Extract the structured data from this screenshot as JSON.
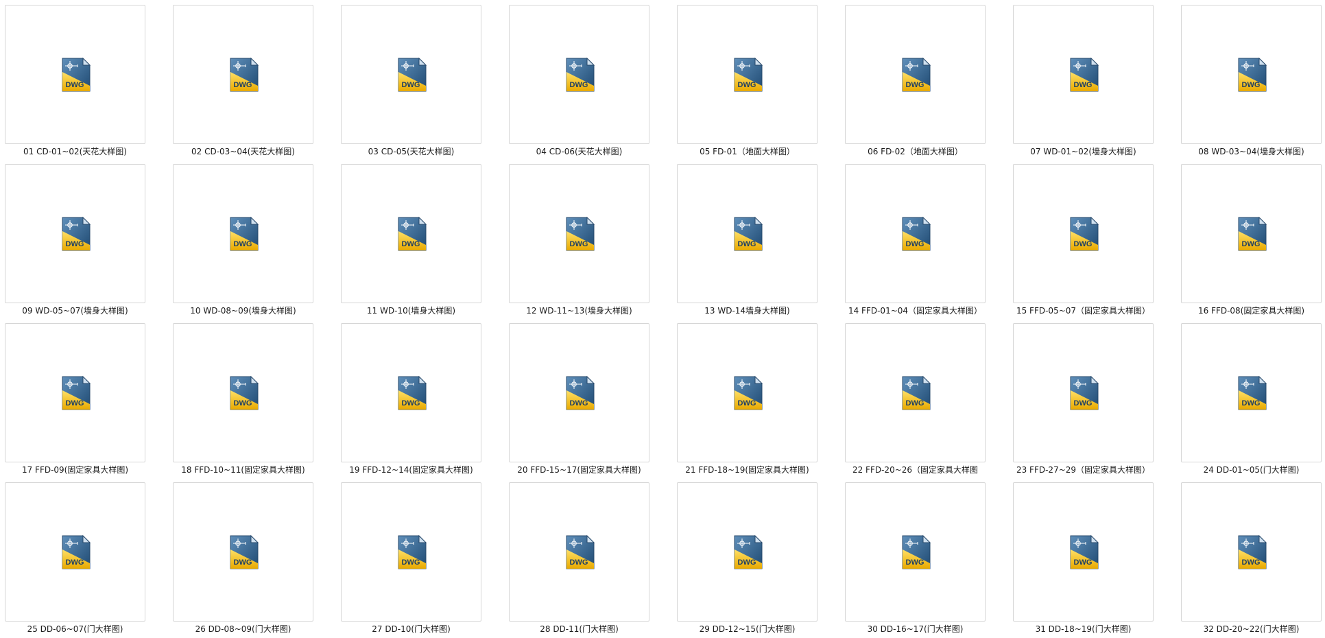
{
  "files": [
    {
      "name": "01 CD-01~02(天花大样图)",
      "icon": "dwg-file-icon"
    },
    {
      "name": "02 CD-03~04(天花大样图)",
      "icon": "dwg-file-icon"
    },
    {
      "name": "03 CD-05(天花大样图)",
      "icon": "dwg-file-icon"
    },
    {
      "name": "04 CD-06(天花大样图)",
      "icon": "dwg-file-icon"
    },
    {
      "name": "05 FD-01（地面大样图）",
      "icon": "dwg-file-icon"
    },
    {
      "name": "06 FD-02（地面大样图）",
      "icon": "dwg-file-icon"
    },
    {
      "name": "07 WD-01~02(墙身大样图)",
      "icon": "dwg-file-icon"
    },
    {
      "name": "08 WD-03~04(墙身大样图)",
      "icon": "dwg-file-icon"
    },
    {
      "name": "09 WD-05~07(墙身大样图)",
      "icon": "dwg-file-icon"
    },
    {
      "name": "10 WD-08~09(墙身大样图)",
      "icon": "dwg-file-icon"
    },
    {
      "name": "11 WD-10(墙身大样图)",
      "icon": "dwg-file-icon"
    },
    {
      "name": "12 WD-11~13(墙身大样图)",
      "icon": "dwg-file-icon"
    },
    {
      "name": "13 WD-14墙身大样图)",
      "icon": "dwg-file-icon"
    },
    {
      "name": "14 FFD-01~04（固定家具大样图）",
      "icon": "dwg-file-icon"
    },
    {
      "name": "15 FFD-05~07（固定家具大样图）",
      "icon": "dwg-file-icon"
    },
    {
      "name": "16 FFD-08(固定家具大样图)",
      "icon": "dwg-file-icon"
    },
    {
      "name": "17 FFD-09(固定家具大样图)",
      "icon": "dwg-file-icon"
    },
    {
      "name": "18 FFD-10~11(固定家具大样图)",
      "icon": "dwg-file-icon"
    },
    {
      "name": "19 FFD-12~14(固定家具大样图)",
      "icon": "dwg-file-icon"
    },
    {
      "name": "20 FFD-15~17(固定家具大样图)",
      "icon": "dwg-file-icon"
    },
    {
      "name": "21 FFD-18~19(固定家具大样图)",
      "icon": "dwg-file-icon"
    },
    {
      "name": "22 FFD-20~26（固定家具大样图",
      "icon": "dwg-file-icon"
    },
    {
      "name": "23 FFD-27~29（固定家具大样图）",
      "icon": "dwg-file-icon"
    },
    {
      "name": "24 DD-01~05(门大样图)",
      "icon": "dwg-file-icon"
    },
    {
      "name": "25 DD-06~07(门大样图)",
      "icon": "dwg-file-icon"
    },
    {
      "name": "26 DD-08~09(门大样图)",
      "icon": "dwg-file-icon"
    },
    {
      "name": "27 DD-10(门大样图)",
      "icon": "dwg-file-icon"
    },
    {
      "name": "28 DD-11(门大样图)",
      "icon": "dwg-file-icon"
    },
    {
      "name": "29 DD-12~15(门大样图)",
      "icon": "dwg-file-icon"
    },
    {
      "name": "30 DD-16~17(门大样图)",
      "icon": "dwg-file-icon"
    },
    {
      "name": "31 DD-18~19(门大样图)",
      "icon": "dwg-file-icon"
    },
    {
      "name": "32 DD-20~22(门大样图)",
      "icon": "dwg-file-icon"
    }
  ],
  "icon_label": "DWG",
  "colors": {
    "icon_blue": "#3a6a94",
    "icon_yellow": "#f2c21b",
    "thumb_border": "#d6d6d6",
    "text": "#1a1a1a"
  }
}
